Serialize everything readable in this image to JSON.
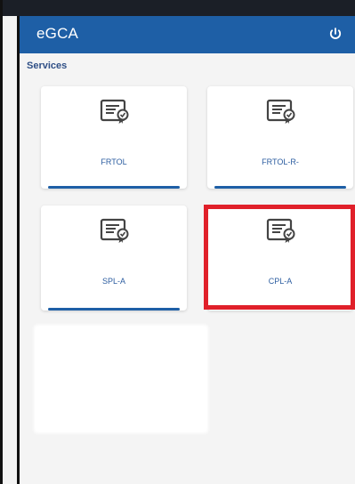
{
  "app": {
    "title": "eGCA",
    "power_icon": "power-icon"
  },
  "section": {
    "title": "Services"
  },
  "services": [
    {
      "label": "FRTOL",
      "icon": "certificate-icon"
    },
    {
      "label": "FRTOL-R-",
      "icon": "certificate-icon"
    },
    {
      "label": "SPL-A",
      "icon": "certificate-icon"
    },
    {
      "label": "CPL-A",
      "icon": "certificate-icon",
      "highlighted": true
    }
  ],
  "colors": {
    "appbar": "#1e5fa6",
    "accent": "#2c5da0",
    "highlight": "#e0202a"
  }
}
